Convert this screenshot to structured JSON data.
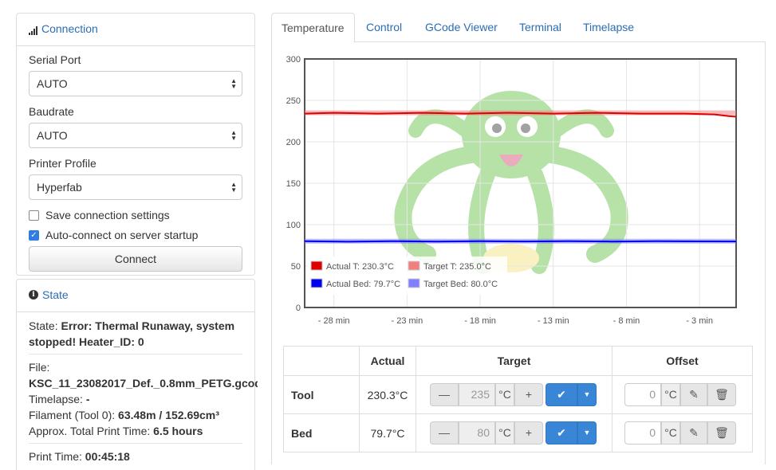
{
  "connection": {
    "title": "Connection",
    "serial_port_label": "Serial Port",
    "serial_port_value": "AUTO",
    "baudrate_label": "Baudrate",
    "baudrate_value": "AUTO",
    "profile_label": "Printer Profile",
    "profile_value": "Hyperfab",
    "save_settings_label": "Save connection settings",
    "save_settings_checked": false,
    "autoconnect_label": "Auto-connect on server startup",
    "autoconnect_checked": true,
    "connect_button": "Connect"
  },
  "state": {
    "title": "State",
    "state_label": "State:",
    "state_value_line1": "Error: Thermal Runaway, system",
    "state_value_line2": "stopped! Heater_ID: 0",
    "file_label": "File:",
    "file_value": "KSC_11_23082017_Def._0.8mm_PETG.gcode",
    "timelapse_label": "Timelapse:",
    "timelapse_value": "-",
    "filament_label": "Filament (Tool 0):",
    "filament_value": "63.48m / 152.69cm³",
    "approx_label": "Approx. Total Print Time:",
    "approx_value": "6.5 hours",
    "print_time_label": "Print Time:",
    "print_time_value": "00:45:18"
  },
  "tabs": [
    "Temperature",
    "Control",
    "GCode Viewer",
    "Terminal",
    "Timelapse"
  ],
  "chart_data": {
    "type": "line",
    "x_ticks": [
      "- 28 min",
      "- 23 min",
      "- 18 min",
      "- 13 min",
      "- 8 min",
      "- 3 min"
    ],
    "y_ticks": [
      0,
      50,
      100,
      150,
      200,
      250,
      300
    ],
    "ylim": [
      0,
      300
    ],
    "xlim_minutes": [
      -30,
      -0.5
    ],
    "grid": true,
    "legend_position": "bottom-left",
    "series": [
      {
        "name": "Actual T: 230.3°C",
        "color": "#dd0000",
        "x": [
          -30,
          -28,
          -25,
          -22,
          -19,
          -16,
          -13,
          -10,
          -7,
          -4,
          -2,
          -1,
          -0.5
        ],
        "y": [
          234,
          235,
          234,
          235,
          234,
          235,
          234,
          235,
          234,
          234,
          233,
          231,
          230.3
        ]
      },
      {
        "name": "Target T: 235.0°C",
        "color": "#f08080",
        "x": [
          -30,
          -0.5
        ],
        "y": [
          235,
          235
        ]
      },
      {
        "name": "Actual Bed: 79.7°C",
        "color": "#0000ee",
        "x": [
          -30,
          -27,
          -24,
          -21,
          -18,
          -15,
          -12,
          -9,
          -6,
          -3,
          -0.5
        ],
        "y": [
          80,
          79.5,
          80,
          79.6,
          80,
          79.7,
          80,
          79.6,
          80,
          79.8,
          79.7
        ]
      },
      {
        "name": "Target Bed: 80.0°C",
        "color": "#7f7fff",
        "x": [
          -30,
          -0.5
        ],
        "y": [
          80,
          80
        ]
      }
    ]
  },
  "temp_table": {
    "headers": [
      "",
      "Actual",
      "Target",
      "Offset"
    ],
    "rows": [
      {
        "name": "Tool",
        "actual": "230.3°C",
        "target": "235",
        "unit": "°C",
        "offset": "0"
      },
      {
        "name": "Bed",
        "actual": "79.7°C",
        "target": "80",
        "unit": "°C",
        "offset": "0"
      }
    ]
  },
  "colors": {
    "link": "#2a6db4",
    "primary_button": "#3a86d6",
    "octopus": "#5fbf3f"
  }
}
